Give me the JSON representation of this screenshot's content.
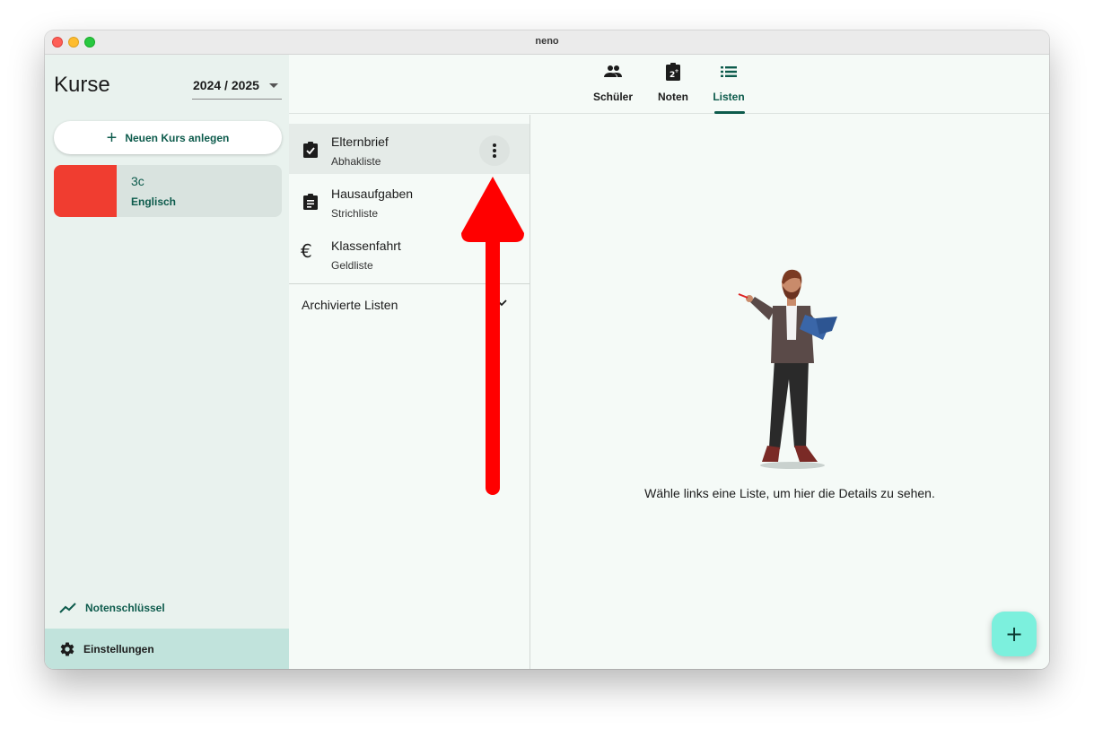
{
  "window": {
    "title": "neno"
  },
  "sidebar": {
    "title": "Kurse",
    "year": "2024 / 2025",
    "new_course_label": "Neuen Kurs anlegen",
    "courses": [
      {
        "name": "3c",
        "subject": "Englisch",
        "color": "#f03d30"
      }
    ],
    "grade_key_label": "Notenschlüssel",
    "settings_label": "Einstellungen"
  },
  "tabs": [
    {
      "label": "Schüler",
      "icon": "people-icon"
    },
    {
      "label": "Noten",
      "icon": "grade-clipboard-icon"
    },
    {
      "label": "Listen",
      "icon": "list-icon",
      "active": true
    }
  ],
  "lists": [
    {
      "title": "Elternbrief",
      "subtitle": "Abhakliste",
      "icon": "clipboard-check-icon",
      "selected": true
    },
    {
      "title": "Hausaufgaben",
      "subtitle": "Strichliste",
      "icon": "clipboard-list-icon"
    },
    {
      "title": "Klassenfahrt",
      "subtitle": "Geldliste",
      "icon": "euro-icon"
    }
  ],
  "archived_label": "Archivierte Listen",
  "detail": {
    "empty_text": "Wähle links eine Liste, um hier die Details zu sehen."
  },
  "colors": {
    "accent": "#0d5b4c",
    "fab": "#7cf0dd",
    "annotation_arrow": "#ff0000"
  }
}
